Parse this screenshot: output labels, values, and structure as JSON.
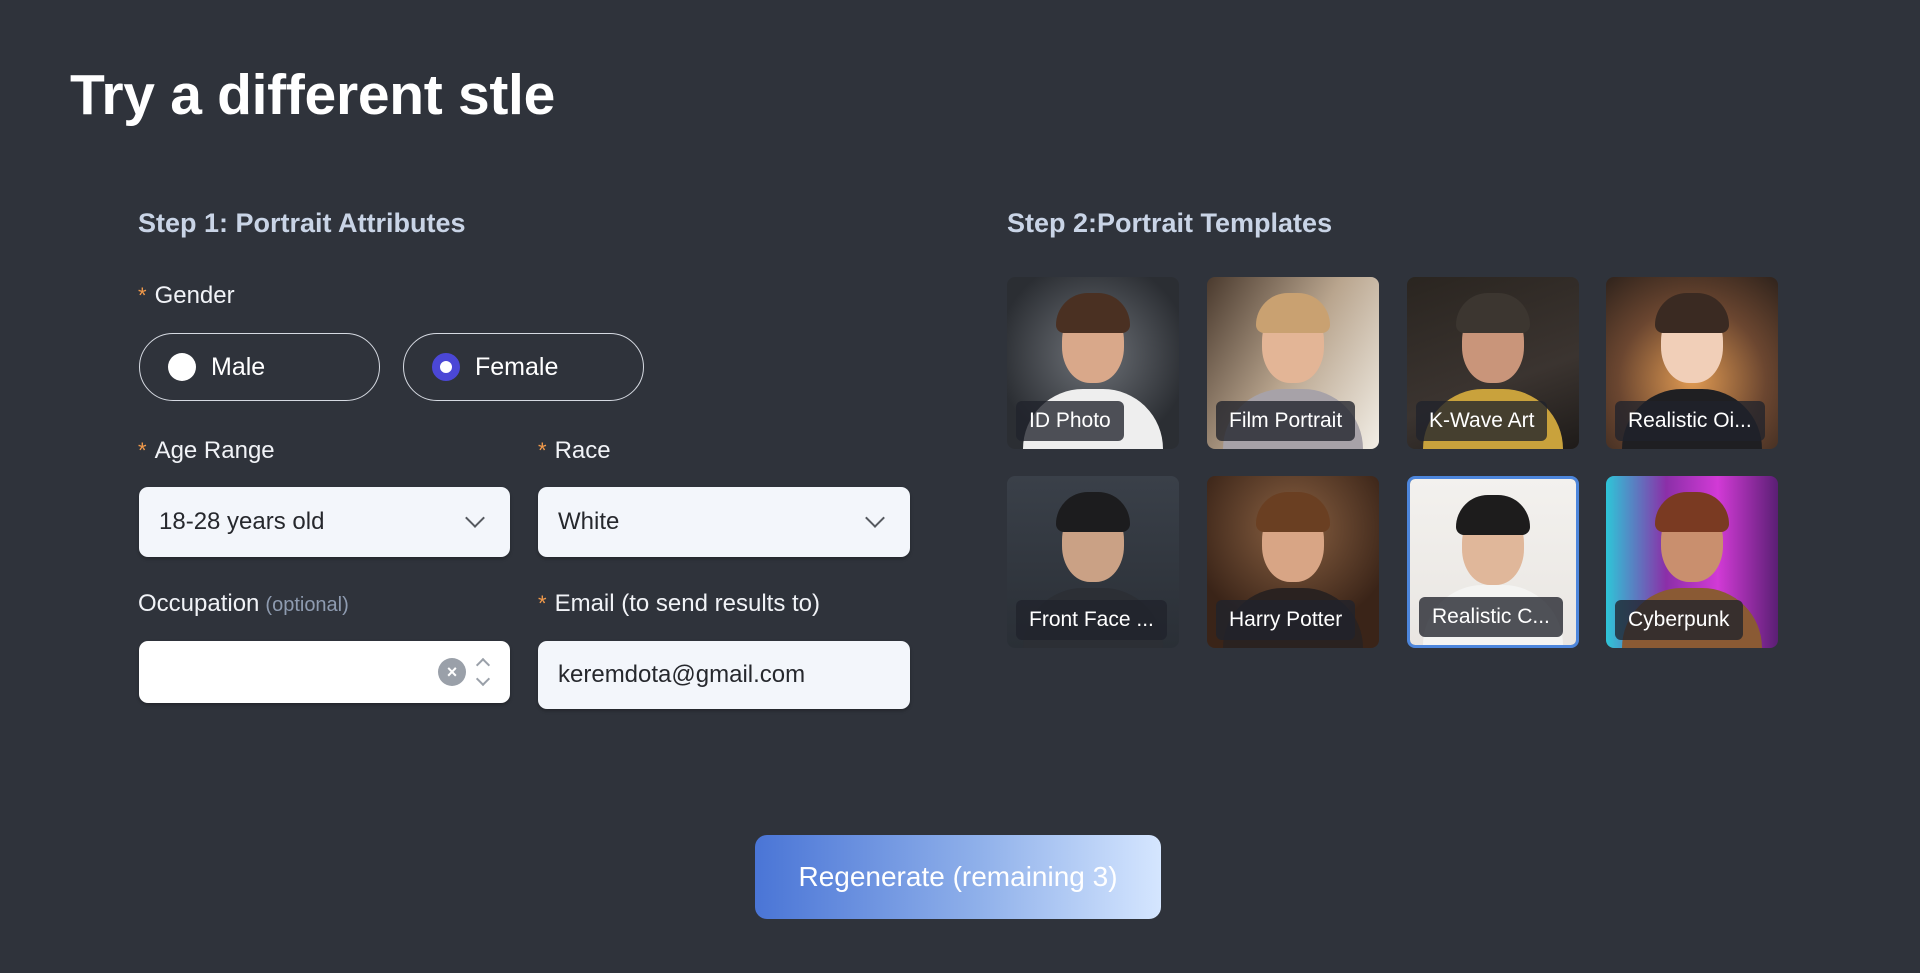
{
  "page": {
    "title": "Try a different stle"
  },
  "step1": {
    "title": "Step 1: Portrait Attributes",
    "gender": {
      "label": "Gender",
      "required_mark": "*",
      "options": [
        {
          "label": "Male",
          "checked": false
        },
        {
          "label": "Female",
          "checked": true
        }
      ]
    },
    "age_range": {
      "label": "Age Range",
      "required_mark": "*",
      "value": "18-28 years old"
    },
    "race": {
      "label": "Race",
      "required_mark": "*",
      "value": "White"
    },
    "occupation": {
      "label": "Occupation",
      "optional_text": "(optional)",
      "value": "",
      "clear_icon": "×"
    },
    "email": {
      "label": "Email (to send results to)",
      "required_mark": "*",
      "value": "keremdota@gmail.com"
    }
  },
  "step2": {
    "title": "Step 2:Portrait Templates",
    "templates": [
      {
        "label": "ID Photo",
        "selected": false
      },
      {
        "label": "Film Portrait",
        "selected": false
      },
      {
        "label": "K-Wave Art",
        "selected": false
      },
      {
        "label": "Realistic Oi...",
        "selected": false
      },
      {
        "label": "Front Face ...",
        "selected": false
      },
      {
        "label": "Harry Potter",
        "selected": false
      },
      {
        "label": "Realistic C...",
        "selected": true
      },
      {
        "label": "Cyberpunk",
        "selected": false
      }
    ]
  },
  "actions": {
    "regenerate_label": "Regenerate (remaining 3)"
  },
  "colors": {
    "background": "#2f333b",
    "accent_radio": "#4b47d6",
    "selected_border": "#4d86dc",
    "required_mark": "#f29a4a"
  }
}
